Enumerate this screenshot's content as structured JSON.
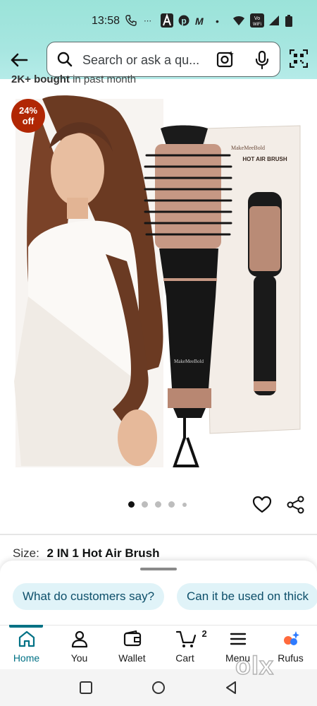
{
  "status_bar": {
    "time": "13:58",
    "icons": [
      "phone-icon",
      "dash-icon",
      "app-a-icon",
      "pinterest-icon",
      "m-icon",
      "dot-icon",
      "wifi-icon",
      "vowifi-icon",
      "signal-icon",
      "battery-icon"
    ]
  },
  "search": {
    "placeholder": "Search or ask a qu...",
    "icons": [
      "back-arrow-icon",
      "search-icon",
      "camera-lens-icon",
      "mic-icon",
      "qr-scan-icon"
    ]
  },
  "product": {
    "bought_text_bold": "2K+ bought",
    "bought_text": " in past month",
    "discount_pct": "24%",
    "discount_word": "off",
    "box_brand": "MakeMeeBold",
    "box_title": "HOT AIR BRUSH",
    "carousel": {
      "total": 5,
      "active_index": 0
    }
  },
  "size": {
    "label": "Size:",
    "value": "2 IN 1 Hot Air Brush"
  },
  "suggestions": [
    "What do customers say?",
    "Can it be used on thick"
  ],
  "bottom_nav": {
    "items": [
      {
        "label": "Home",
        "icon": "home-icon"
      },
      {
        "label": "You",
        "icon": "person-icon"
      },
      {
        "label": "Wallet",
        "icon": "wallet-icon"
      },
      {
        "label": "Cart",
        "icon": "cart-icon"
      },
      {
        "label": "Menu",
        "icon": "menu-icon"
      },
      {
        "label": "Rufus",
        "icon": "rufus-icon"
      }
    ],
    "cart_count": "2",
    "active": "Home"
  },
  "watermark": "olx",
  "colors": {
    "header_teal": "#a6e6e0",
    "accent": "#007185",
    "discount_red": "#b12704",
    "chip_bg": "#e0f3f8"
  }
}
